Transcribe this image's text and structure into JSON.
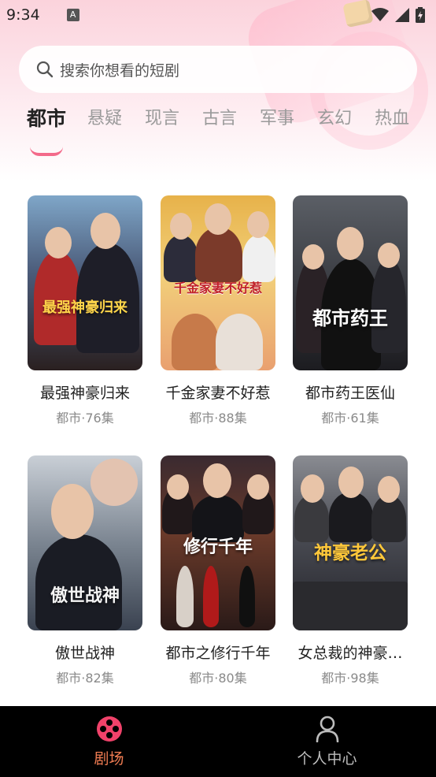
{
  "status_bar": {
    "time": "9:34",
    "notice_glyph": "A"
  },
  "search": {
    "placeholder": "搜索你想看的短剧"
  },
  "tabs": [
    {
      "label": "都市",
      "active": true
    },
    {
      "label": "悬疑",
      "active": false
    },
    {
      "label": "现言",
      "active": false
    },
    {
      "label": "古言",
      "active": false
    },
    {
      "label": "军事",
      "active": false
    },
    {
      "label": "玄幻",
      "active": false
    },
    {
      "label": "热血",
      "active": false
    }
  ],
  "dramas": [
    {
      "title": "最强神豪归来",
      "meta": "都市·76集",
      "poster_text": "最强神豪归来"
    },
    {
      "title": "千金家妻不好惹",
      "meta": "都市·88集",
      "poster_text": "千金家妻不好惹"
    },
    {
      "title": "都市药王医仙",
      "meta": "都市·61集",
      "poster_text": "都市药王"
    },
    {
      "title": "傲世战神",
      "meta": "都市·82集",
      "poster_text": "傲世战神"
    },
    {
      "title": "都市之修行千年",
      "meta": "都市·80集",
      "poster_text": "修行千年"
    },
    {
      "title": "女总裁的神豪…",
      "meta": "都市·98集",
      "poster_text": "神豪老公"
    }
  ],
  "bottom_nav": [
    {
      "label": "剧场",
      "icon": "film-reel-icon",
      "active": true
    },
    {
      "label": "个人中心",
      "icon": "person-icon",
      "active": false
    }
  ],
  "colors": {
    "accent": "#f36a8a",
    "nav_active": "#f07c52",
    "nav_bg": "#000000"
  }
}
